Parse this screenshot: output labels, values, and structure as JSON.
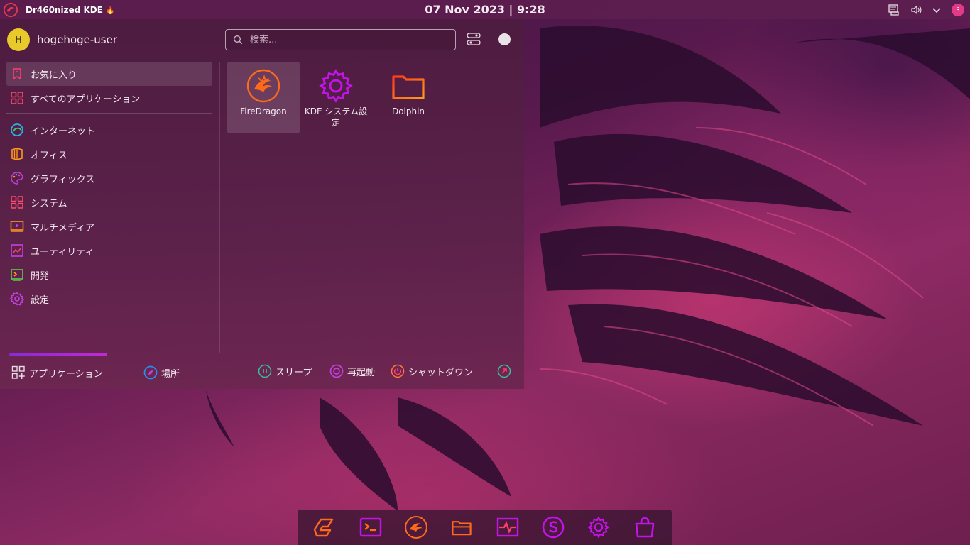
{
  "top_panel": {
    "title": "Dr460nized KDE",
    "title_emoji": "🔥",
    "clock": "07 Nov 2023 | 9:28",
    "tray_avatar": "R"
  },
  "launcher": {
    "user": {
      "initial": "H",
      "name": "hogehoge-user"
    },
    "search": {
      "placeholder": "検索..."
    },
    "categories": [
      {
        "label": "お気に入り",
        "icon": "bookmark-icon"
      },
      {
        "label": "すべてのアプリケーション",
        "icon": "grid-icon"
      },
      {
        "label": "インターネット",
        "icon": "globe-icon"
      },
      {
        "label": "オフィス",
        "icon": "office-icon"
      },
      {
        "label": "グラフィックス",
        "icon": "palette-icon"
      },
      {
        "label": "システム",
        "icon": "grid-icon"
      },
      {
        "label": "マルチメディア",
        "icon": "video-icon"
      },
      {
        "label": "ユーティリティ",
        "icon": "chart-icon"
      },
      {
        "label": "開発",
        "icon": "chip-icon"
      },
      {
        "label": "設定",
        "icon": "gear-icon"
      }
    ],
    "favorites": [
      {
        "label": "FireDragon",
        "icon": "firedragon-icon"
      },
      {
        "label": "KDE システム設定",
        "icon": "gear-icon"
      },
      {
        "label": "Dolphin",
        "icon": "folder-icon"
      }
    ],
    "bottom": {
      "tab_apps": "アプリケーション",
      "tab_places": "場所",
      "sleep": "スリープ",
      "restart": "再起動",
      "shutdown": "シャットダウン"
    }
  },
  "dock": {
    "items": [
      "garuda-gamer-icon",
      "terminal-icon",
      "firedragon-icon",
      "folder-icon",
      "system-monitor-icon",
      "software-icon",
      "settings-icon",
      "store-icon"
    ]
  },
  "colors": {
    "accent_orange": "#ff6a1a",
    "accent_magenta": "#c214e8",
    "accent_pink": "#ff3d7f"
  }
}
